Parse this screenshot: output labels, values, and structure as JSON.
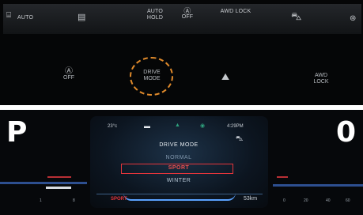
{
  "top_controls": {
    "strip": {
      "auto_defrost_label": "AUTO",
      "hold_label": "AUTO HOLD",
      "esc_off_label": "OFF",
      "awd_lock_label": "AWD LOCK"
    },
    "row": {
      "esc_off_label": "OFF",
      "drive_mode_label": "DRIVE MODE",
      "awd_lock_label": "AWD LOCK"
    },
    "highlight_color": "#e08a2b"
  },
  "cluster": {
    "left_gear": "P",
    "right_gear": "0",
    "status": {
      "temperature": "23°c",
      "time": "4:29PM"
    },
    "menu": {
      "title": "DRIVE MODE",
      "options": [
        "NORMAL",
        "SPORT",
        "WINTER"
      ],
      "selected": "SPORT"
    },
    "mode_badge": "SPORT",
    "range": "53km",
    "left_scale": [
      "1",
      "8"
    ],
    "right_scale": [
      "0",
      "20",
      "40",
      "60"
    ],
    "accent_red": "#e3353b",
    "accent_blue": "#3f79d8"
  }
}
